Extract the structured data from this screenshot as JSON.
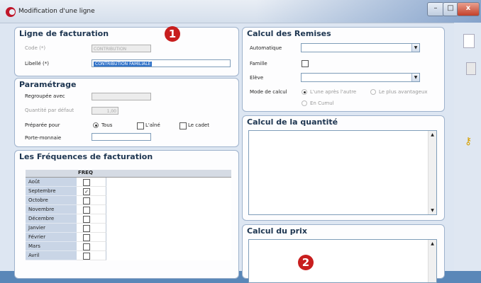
{
  "window": {
    "title": "Modification d'une ligne",
    "controls": {
      "minimize": "–",
      "maximize": "□",
      "close": "x"
    }
  },
  "ligne": {
    "title": "Ligne de facturation",
    "code_label": "Code (*)",
    "code_value": "CONTRIBUTION",
    "libelle_label": "Libellé (*)",
    "libelle_value": "CONTRIBUTION FAMILIALE"
  },
  "parametrage": {
    "title": "Paramétrage",
    "regroupee_label": "Regroupée avec",
    "quantite_label": "Quantité par défaut",
    "quantite_value": "1,00",
    "preparee_label": "Préparée pour",
    "options": [
      "Tous",
      "L'aîné",
      "Le cadet"
    ],
    "selected": "Tous",
    "porte_label": "Porte-monnaie"
  },
  "frequences": {
    "title": "Les Fréquences de facturation",
    "column": "FREQ",
    "months": [
      {
        "name": "Août",
        "checked": false
      },
      {
        "name": "Septembre",
        "checked": true
      },
      {
        "name": "Octobre",
        "checked": false
      },
      {
        "name": "Novembre",
        "checked": false
      },
      {
        "name": "Décembre",
        "checked": false
      },
      {
        "name": "Janvier",
        "checked": false
      },
      {
        "name": "Février",
        "checked": false
      },
      {
        "name": "Mars",
        "checked": false
      },
      {
        "name": "Avril",
        "checked": false
      }
    ]
  },
  "remises": {
    "title": "Calcul des Remises",
    "automatique_label": "Automatique",
    "famille_label": "Famille",
    "eleve_label": "Elève",
    "mode_label": "Mode de calcul",
    "mode_options": [
      "L'une après l'autre",
      "Le plus avantageux",
      "En Cumul"
    ]
  },
  "quantite": {
    "title": "Calcul de la quantité"
  },
  "prix": {
    "title": "Calcul du prix"
  },
  "badges": {
    "one": "1",
    "two": "2"
  },
  "colors": {
    "badge": "#c81e1e",
    "accent": "#3072c8",
    "title": "#1d3550"
  }
}
